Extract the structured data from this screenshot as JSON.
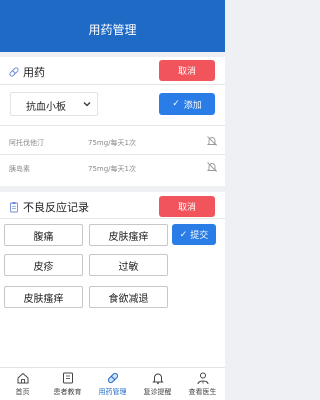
{
  "header": {
    "title": "用药管理"
  },
  "medication": {
    "title": "用药",
    "cancel_label": "取消",
    "select_value": "抗血小板",
    "add_label": "添加",
    "rows": [
      {
        "name": "阿托伐他汀",
        "dose": "75mg/每天1次"
      },
      {
        "name": "胰岛素",
        "dose": "75mg/每天1次"
      }
    ]
  },
  "adverse": {
    "title": "不良反应记录",
    "cancel_label": "取消",
    "submit_label": "提交",
    "tags": [
      "腹痛",
      "皮肤瘙痒",
      "皮疹",
      "过敏",
      "皮肤瘙痒",
      "食欲减退"
    ]
  },
  "tabbar": {
    "items": [
      {
        "label": "首页",
        "icon": "home-icon"
      },
      {
        "label": "患者教育",
        "icon": "book-icon"
      },
      {
        "label": "用药管理",
        "icon": "pill-icon"
      },
      {
        "label": "复诊提醒",
        "icon": "bell-icon"
      },
      {
        "label": "查看医生",
        "icon": "doctor-icon"
      }
    ],
    "active_index": 2
  },
  "colors": {
    "primary": "#1f6ac4",
    "accent": "#2a7ce6",
    "danger": "#f2545b"
  }
}
